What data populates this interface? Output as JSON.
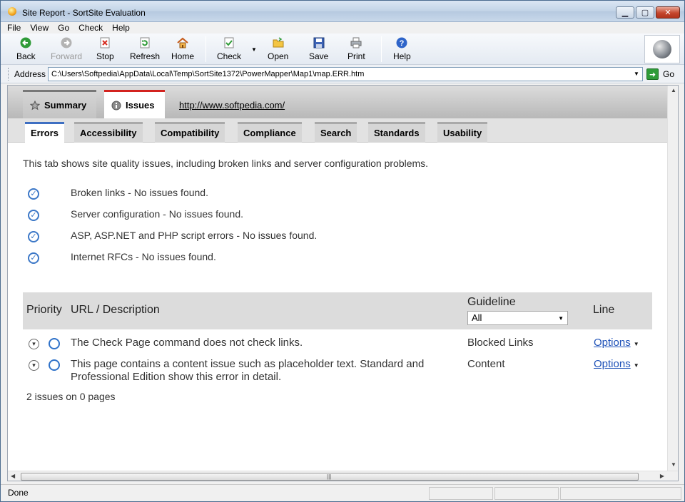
{
  "window": {
    "title": "Site Report - SortSite Evaluation"
  },
  "menu": [
    "File",
    "View",
    "Go",
    "Check",
    "Help"
  ],
  "toolbar": {
    "back": "Back",
    "forward": "Forward",
    "stop": "Stop",
    "refresh": "Refresh",
    "home": "Home",
    "check": "Check",
    "open": "Open",
    "save": "Save",
    "print": "Print",
    "help": "Help"
  },
  "address": {
    "label": "Address",
    "value": "C:\\Users\\Softpedia\\AppData\\Local\\Temp\\SortSite1372\\PowerMapper\\Map1\\map.ERR.htm",
    "go": "Go"
  },
  "report": {
    "tabs": {
      "summary": "Summary",
      "issues": "Issues"
    },
    "site_link": "http://www.softpedia.com/",
    "subtabs": [
      "Errors",
      "Accessibility",
      "Compatibility",
      "Compliance",
      "Search",
      "Standards",
      "Usability"
    ],
    "intro": "This tab shows site quality issues, including broken links and server configuration problems.",
    "checks": [
      "Broken links - No issues found.",
      "Server configuration - No issues found.",
      "ASP, ASP.NET and PHP script errors - No issues found.",
      "Internet RFCs - No issues found."
    ],
    "table": {
      "priority": "Priority",
      "url": "URL / Description",
      "guideline": "Guideline",
      "guideline_filter": "All",
      "line": "Line"
    },
    "issues": [
      {
        "description": "The Check Page command does not check links.",
        "guideline": "Blocked Links",
        "options": "Options"
      },
      {
        "description": "This page contains a content issue such as placeholder text. Standard and Professional Edition show this error in detail.",
        "guideline": "Content",
        "options": "Options"
      }
    ],
    "summary": "2 issues on 0 pages"
  },
  "status": {
    "text": "Done"
  },
  "colors": {
    "accent": "#3e6fc2",
    "issues_tab": "#d3231f",
    "check_icon": "#3b77c7",
    "link": "#1f52b8"
  }
}
